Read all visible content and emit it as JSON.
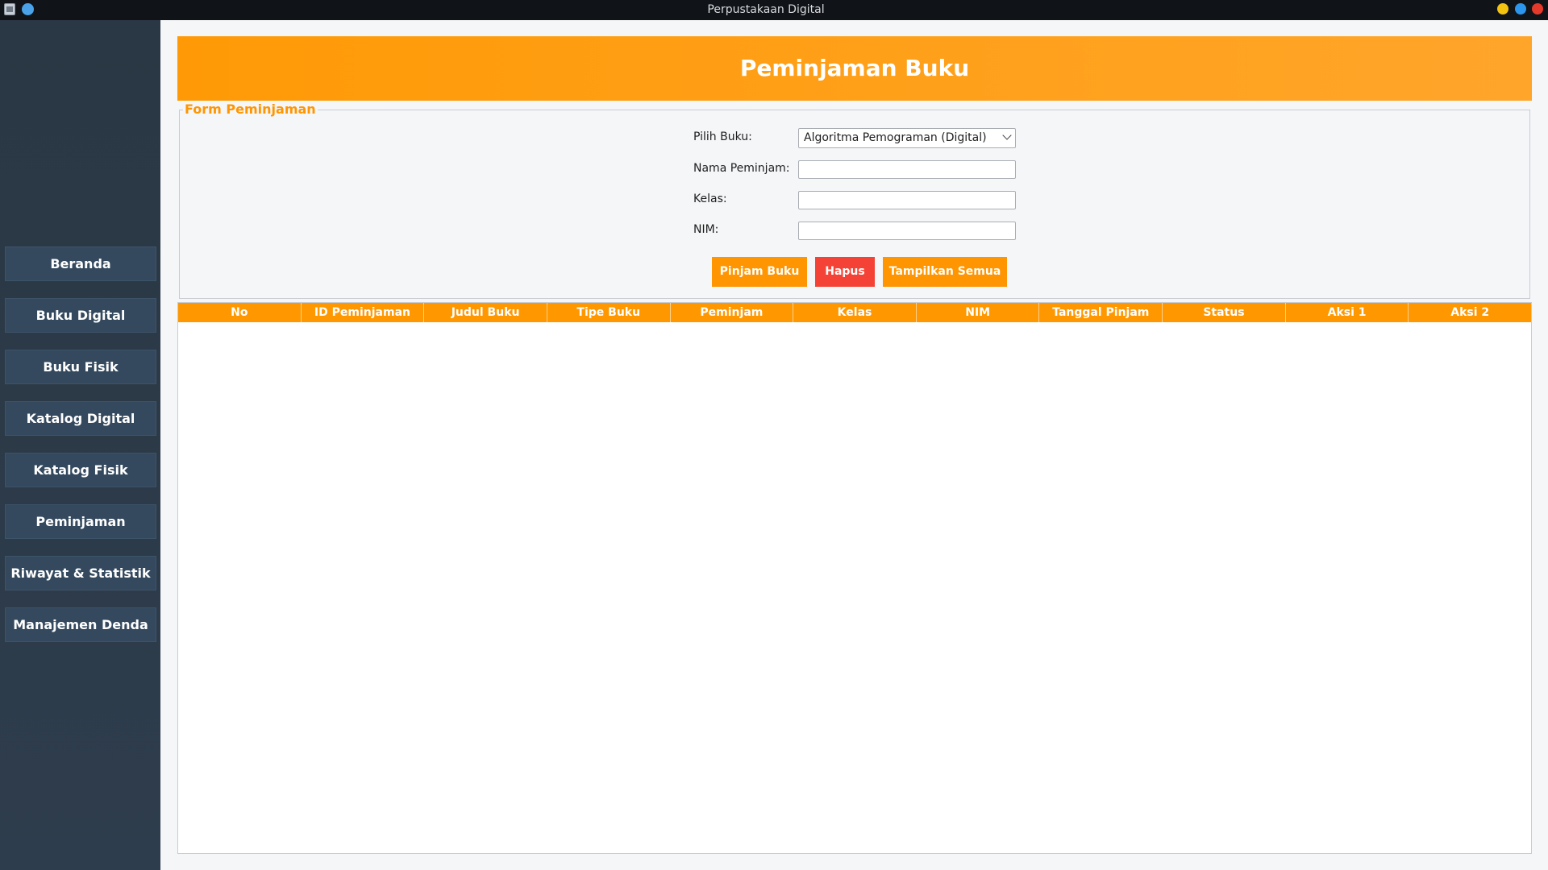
{
  "window": {
    "title": "Perpustakaan Digital"
  },
  "sidebar": {
    "items": [
      {
        "label": "Beranda"
      },
      {
        "label": "Buku Digital"
      },
      {
        "label": "Buku Fisik"
      },
      {
        "label": "Katalog Digital"
      },
      {
        "label": "Katalog Fisik"
      },
      {
        "label": "Peminjaman"
      },
      {
        "label": "Riwayat & Statistik"
      },
      {
        "label": "Manajemen Denda"
      }
    ]
  },
  "header": {
    "title": "Peminjaman Buku"
  },
  "form": {
    "legend": "Form Peminjaman",
    "book_label": "Pilih Buku:",
    "book_selected": "Algoritma Pemograman (Digital)",
    "name_label": "Nama Peminjam:",
    "name_value": "",
    "class_label": "Kelas:",
    "class_value": "",
    "nim_label": "NIM:",
    "nim_value": "",
    "borrow_button": "Pinjam Buku",
    "delete_button": "Hapus",
    "show_all_button": "Tampilkan Semua"
  },
  "table": {
    "columns": [
      "No",
      "ID Peminjaman",
      "Judul Buku",
      "Tipe Buku",
      "Peminjam",
      "Kelas",
      "NIM",
      "Tanggal Pinjam",
      "Status",
      "Aksi 1",
      "Aksi 2"
    ],
    "rows": []
  },
  "colors": {
    "accent": "#ff9500",
    "danger": "#f44336",
    "sidebar": "#2c3e50",
    "nav_button": "#34495e"
  },
  "icons": {
    "app": "app-icon",
    "pin": "pin-icon",
    "dropdown": "chevron-down-icon",
    "minimize": "minimize-icon",
    "maximize": "maximize-icon",
    "close": "close-icon"
  }
}
